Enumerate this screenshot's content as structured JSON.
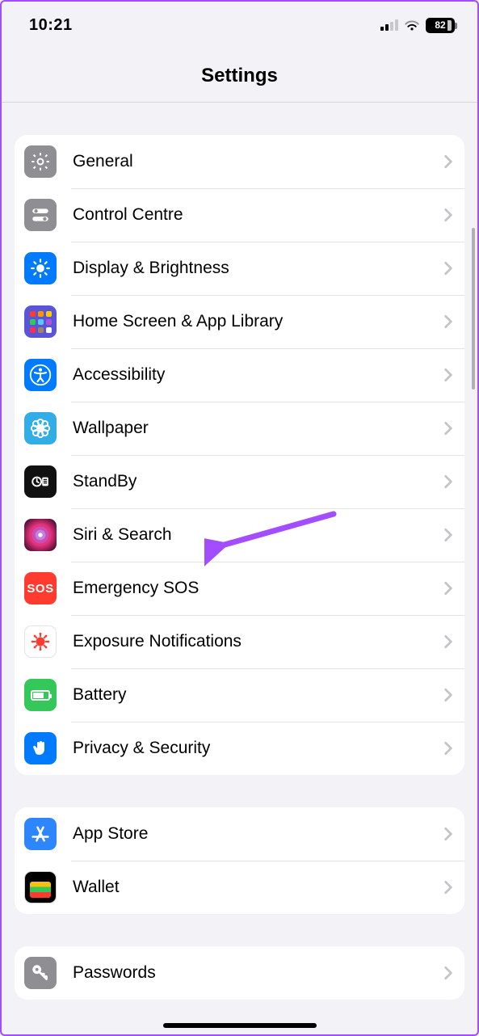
{
  "status": {
    "time": "10:21",
    "battery": "82"
  },
  "nav": {
    "title": "Settings"
  },
  "groups": [
    {
      "rows": [
        {
          "id": "general",
          "label": "General",
          "icon": "gear-icon",
          "bg": "bg-gray"
        },
        {
          "id": "control-centre",
          "label": "Control Centre",
          "icon": "toggles-icon",
          "bg": "bg-gray"
        },
        {
          "id": "display",
          "label": "Display & Brightness",
          "icon": "sun-icon",
          "bg": "bg-blue"
        },
        {
          "id": "home-screen",
          "label": "Home Screen & App Library",
          "icon": "apps-icon",
          "bg": "hsapps"
        },
        {
          "id": "accessibility",
          "label": "Accessibility",
          "icon": "accessibility-icon",
          "bg": "bg-blue"
        },
        {
          "id": "wallpaper",
          "label": "Wallpaper",
          "icon": "flower-icon",
          "bg": "bg-cyan"
        },
        {
          "id": "standby",
          "label": "StandBy",
          "icon": "standby-icon",
          "bg": "bg-dark"
        },
        {
          "id": "siri",
          "label": "Siri & Search",
          "icon": "siri-icon",
          "bg": "bg-siri"
        },
        {
          "id": "sos",
          "label": "Emergency SOS",
          "icon": "sos-icon",
          "bg": "bg-red"
        },
        {
          "id": "exposure",
          "label": "Exposure Notifications",
          "icon": "virus-icon",
          "bg": "bg-white"
        },
        {
          "id": "battery",
          "label": "Battery",
          "icon": "battery-icon",
          "bg": "bg-green"
        },
        {
          "id": "privacy",
          "label": "Privacy & Security",
          "icon": "hand-icon",
          "bg": "bg-blue"
        }
      ]
    },
    {
      "rows": [
        {
          "id": "appstore",
          "label": "App Store",
          "icon": "appstore-icon",
          "bg": "bg-blue2"
        },
        {
          "id": "wallet",
          "label": "Wallet",
          "icon": "wallet-icon",
          "bg": "wallet-card"
        }
      ]
    },
    {
      "rows": [
        {
          "id": "passwords",
          "label": "Passwords",
          "icon": "key-icon",
          "bg": "bg-gray"
        }
      ]
    }
  ],
  "annotation": {
    "target": "siri",
    "color": "#a24dff"
  }
}
